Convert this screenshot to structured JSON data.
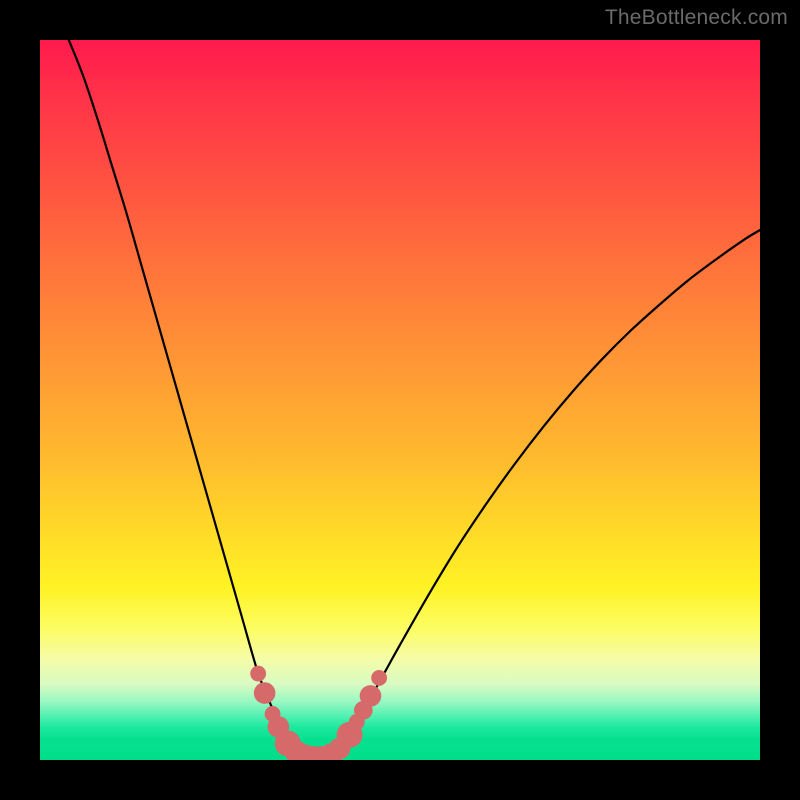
{
  "watermark": "TheBottleneck.com",
  "colors": {
    "background": "#000000",
    "curve": "#000000",
    "marker_fill": "#d66a6a",
    "marker_stroke": "#c94f4f",
    "gradient_top": "#ff1a4d",
    "gradient_bottom": "#00de89"
  },
  "chart_data": {
    "type": "line",
    "title": "",
    "xlabel": "",
    "ylabel": "",
    "xlim": [
      0,
      100
    ],
    "ylim": [
      0,
      100
    ],
    "grid": false,
    "legend": false,
    "note": "Axes are normalized 0–100 for both x and y; no tick labels are shown in the original. Curve is a V/U shape with the trough near x≈36 at y≈0. Markers are the highlighted points near the trough.",
    "series": [
      {
        "name": "bottleneck-curve",
        "x": [
          4,
          6,
          8,
          10,
          12,
          14,
          16,
          18,
          20,
          22,
          24,
          26,
          28,
          30,
          31,
          32,
          33,
          34,
          35,
          36,
          37,
          38,
          39,
          40,
          41,
          42,
          44,
          46,
          48,
          50,
          54,
          58,
          62,
          66,
          70,
          74,
          78,
          82,
          86,
          90,
          94,
          98,
          100
        ],
        "y": [
          100,
          95,
          89,
          82.5,
          76,
          69,
          62,
          55,
          48,
          41,
          34,
          27,
          20,
          13,
          10.2,
          7.8,
          5.6,
          3.8,
          2.4,
          1.4,
          0.8,
          0.4,
          0.25,
          0.5,
          1.2,
          2.4,
          5.4,
          8.8,
          12.4,
          16,
          23,
          29.6,
          35.6,
          41.2,
          46.4,
          51.2,
          55.6,
          59.6,
          63.2,
          66.6,
          69.6,
          72.4,
          73.6
        ]
      }
    ],
    "markers": {
      "name": "trough-markers",
      "points": [
        {
          "x": 30.3,
          "y": 12.0,
          "r": 1.1
        },
        {
          "x": 31.2,
          "y": 9.3,
          "r": 1.5
        },
        {
          "x": 32.3,
          "y": 6.4,
          "r": 1.1
        },
        {
          "x": 33.1,
          "y": 4.6,
          "r": 1.5
        },
        {
          "x": 34.4,
          "y": 2.3,
          "r": 1.8
        },
        {
          "x": 35.6,
          "y": 1.1,
          "r": 1.6
        },
        {
          "x": 36.8,
          "y": 0.55,
          "r": 1.6
        },
        {
          "x": 38.0,
          "y": 0.35,
          "r": 1.6
        },
        {
          "x": 39.2,
          "y": 0.35,
          "r": 1.6
        },
        {
          "x": 40.4,
          "y": 0.7,
          "r": 1.6
        },
        {
          "x": 41.6,
          "y": 1.6,
          "r": 1.5
        },
        {
          "x": 43.0,
          "y": 3.5,
          "r": 1.8
        },
        {
          "x": 44.0,
          "y": 5.3,
          "r": 1.1
        },
        {
          "x": 44.9,
          "y": 6.9,
          "r": 1.3
        },
        {
          "x": 45.9,
          "y": 8.9,
          "r": 1.5
        },
        {
          "x": 47.1,
          "y": 11.4,
          "r": 1.1
        }
      ]
    }
  }
}
